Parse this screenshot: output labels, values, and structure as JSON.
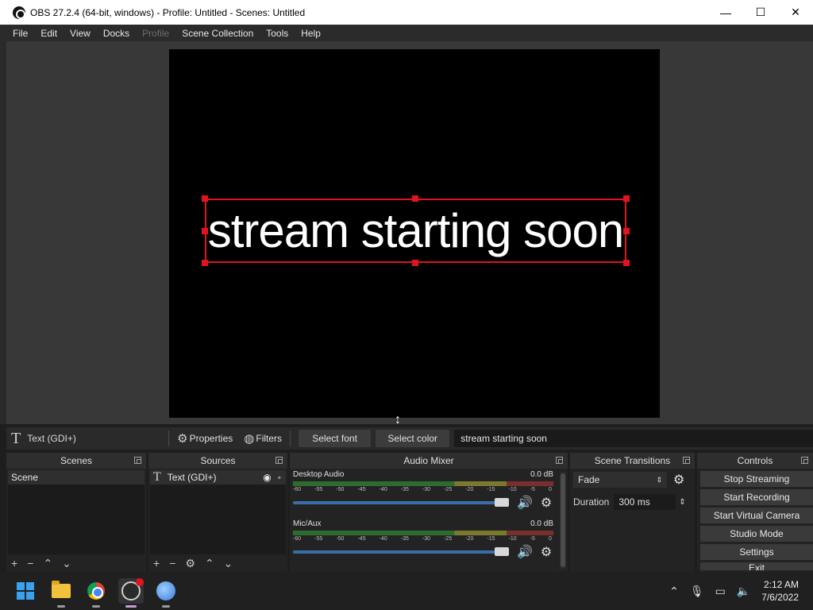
{
  "window": {
    "title": "OBS 27.2.4 (64-bit, windows) - Profile: Untitled - Scenes: Untitled",
    "minimize": "—",
    "maximize": "☐",
    "close": "✕"
  },
  "menu": [
    "File",
    "Edit",
    "View",
    "Docks",
    "Profile",
    "Scene Collection",
    "Tools",
    "Help"
  ],
  "preview": {
    "text": "stream starting soon"
  },
  "context_bar": {
    "source_name": "Text (GDI+)",
    "properties": "Properties",
    "filters": "Filters",
    "select_font": "Select font",
    "select_color": "Select color",
    "text_value": "stream starting soon"
  },
  "scenes": {
    "title": "Scenes",
    "items": [
      "Scene"
    ]
  },
  "sources": {
    "title": "Sources",
    "items": [
      "Text (GDI+)"
    ]
  },
  "audio_mixer": {
    "title": "Audio Mixer",
    "channels": [
      {
        "name": "Desktop Audio",
        "level": "0.0 dB",
        "volume": 1.0
      },
      {
        "name": "Mic/Aux",
        "level": "0.0 dB",
        "volume": 1.0
      }
    ],
    "ticks": [
      "-60",
      "-55",
      "-50",
      "-45",
      "-40",
      "-35",
      "-30",
      "-25",
      "-20",
      "-15",
      "-10",
      "-5",
      "0"
    ]
  },
  "transitions": {
    "title": "Scene Transitions",
    "selected": "Fade",
    "duration_label": "Duration",
    "duration_value": "300 ms"
  },
  "controls": {
    "title": "Controls",
    "buttons": [
      "Stop Streaming",
      "Start Recording",
      "Start Virtual Camera",
      "Studio Mode",
      "Settings",
      "Exit"
    ]
  },
  "taskbar": {
    "time": "2:12 AM",
    "date": "7/6/2022"
  },
  "colors": {
    "selection": "#e0141e",
    "volume_slider": "#3a6ea8"
  }
}
